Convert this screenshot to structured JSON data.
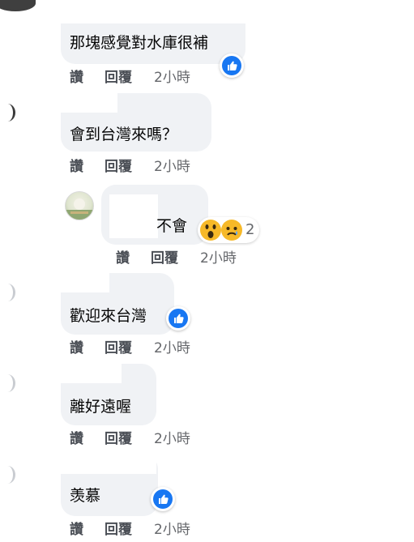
{
  "comments": [
    {
      "text": "那塊感覺對水庫很補",
      "reaction": "like-icon",
      "actions": {
        "like": "讚",
        "reply": "回覆",
        "time": "2小時"
      }
    },
    {
      "text": "會到台灣來嗎？",
      "actions": {
        "like": "讚",
        "reply": "回覆",
        "time": "2小時"
      }
    },
    {
      "text": "不會",
      "reactions": [
        "wow-icon",
        "sad-icon"
      ],
      "reaction_count": "2",
      "actions": {
        "like": "讚",
        "reply": "回覆",
        "time": "2小時"
      }
    },
    {
      "text": "歡迎來台灣",
      "reaction": "like-icon",
      "actions": {
        "like": "讚",
        "reply": "回覆",
        "time": "2小時"
      }
    },
    {
      "text": "離好遠喔",
      "actions": {
        "like": "讚",
        "reply": "回覆",
        "time": "2小時"
      }
    },
    {
      "text": "羡慕",
      "reaction": "like-icon",
      "actions": {
        "like": "讚",
        "reply": "回覆",
        "time": "2小時"
      }
    }
  ],
  "colors": {
    "bubble": "#f0f2f5",
    "like_blue": "#1877f2",
    "secondary_text": "#65676b"
  }
}
